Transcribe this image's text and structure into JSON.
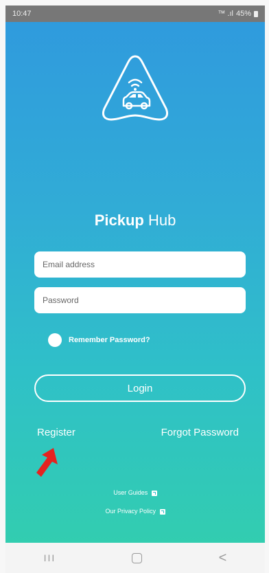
{
  "status_bar": {
    "time": "10:47",
    "signal_text": "™ .ıl",
    "battery": "45%"
  },
  "app": {
    "title_bold": "Pickup",
    "title_rest": "Hub"
  },
  "form": {
    "email_placeholder": "Email address",
    "password_placeholder": "Password",
    "remember_label": "Remember Password?",
    "login_label": "Login"
  },
  "links": {
    "register": "Register",
    "forgot_password": "Forgot Password",
    "user_guides": "User Guides",
    "privacy_policy": "Our Privacy Policy"
  },
  "nav": {
    "recent": "III",
    "back": "<"
  },
  "colors": {
    "gradient_top": "#2f99de",
    "gradient_bottom": "#32cdb0",
    "arrow": "#e52320"
  }
}
